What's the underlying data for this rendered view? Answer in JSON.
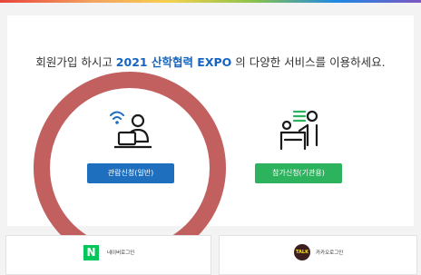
{
  "headline": {
    "before": "회원가입 하시고 ",
    "highlight": "2021 산학협력 EXPO",
    "after": " 의 다양한 서비스를 이용하세요."
  },
  "options": [
    {
      "label": "관람신청(일반)",
      "icon": "person-laptop-wifi-icon",
      "color": "#1f6fbf"
    },
    {
      "label": "참가신청(기관용)",
      "icon": "presenter-desk-icon",
      "color": "#2db35d"
    }
  ],
  "social_login": [
    {
      "label": "네이버로그인",
      "logo_text": "N",
      "color": "#03c75a"
    },
    {
      "label": "카카오로그인",
      "logo_text": "TALK",
      "color": "#3c1e1e"
    }
  ],
  "annotation": {
    "shape": "circle-highlight",
    "color": "#b94a4a"
  }
}
